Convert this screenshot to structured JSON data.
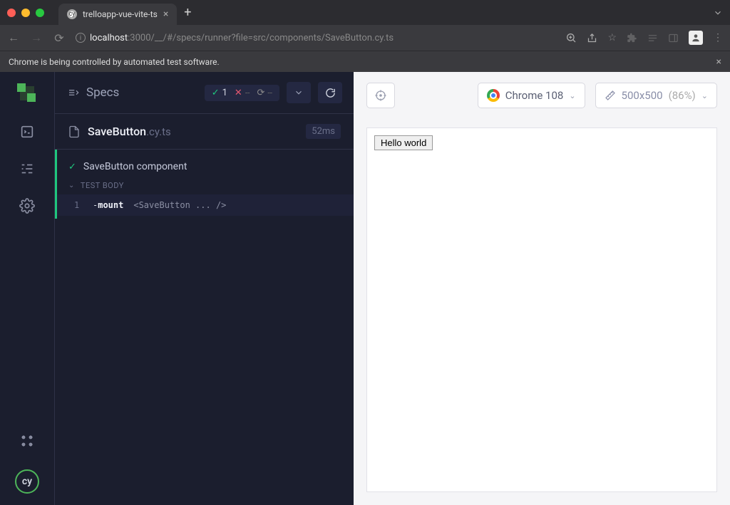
{
  "browser": {
    "tab_title": "trelloapp-vue-vite-ts",
    "url_host": "localhost",
    "url_port": ":3000",
    "url_path": "/__/#/specs/runner?file=src/components/SaveButton.cy.ts",
    "automation_banner": "Chrome is being controlled by automated test software."
  },
  "reporter": {
    "specs_label": "Specs",
    "stats": {
      "passed": "1",
      "failed": "--",
      "pending": "--"
    },
    "spec_file_name": "SaveButton",
    "spec_file_ext": ".cy.ts",
    "duration": "52ms",
    "test_title": "SaveButton component",
    "body_label": "TEST BODY",
    "command": {
      "num": "1",
      "dash": "-",
      "name": "mount",
      "args": "<SaveButton ... />"
    }
  },
  "aut": {
    "browser_label": "Chrome 108",
    "viewport_size": "500x500",
    "viewport_scale": "(86%)",
    "rendered_button": "Hello world"
  }
}
